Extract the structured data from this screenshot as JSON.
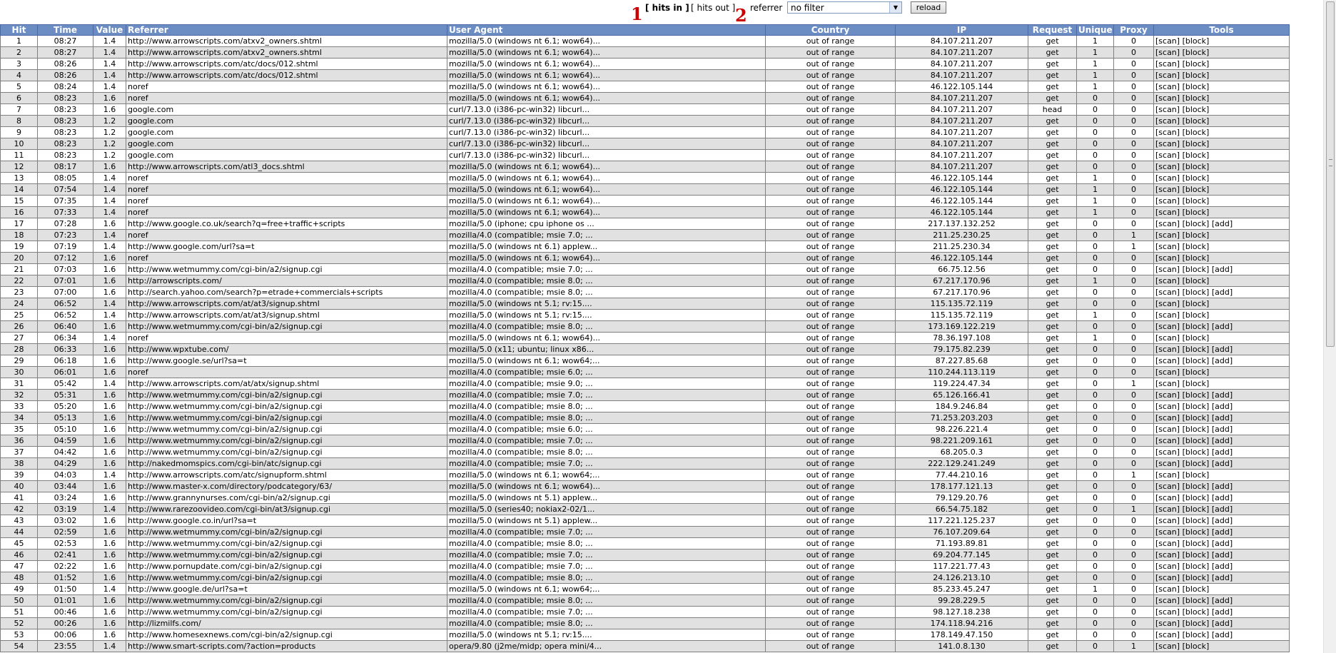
{
  "toolbar": {
    "hits_in": "[ hits in ]",
    "hits_out": "[ hits out ]",
    "filter_label": "referrer",
    "filter_value": "no filter",
    "reload": "reload"
  },
  "annotations": [
    "1",
    "2"
  ],
  "columns": [
    "Hit",
    "Time",
    "Value",
    "Referrer",
    "User Agent",
    "Country",
    "IP",
    "Request",
    "Unique",
    "Proxy",
    "Tools"
  ],
  "rows": [
    [
      "1",
      "08:27",
      "1.4",
      "http://www.arrowscripts.com/atxv2_owners.shtml",
      "mozilla/5.0 (windows nt 6.1; wow64)...",
      "out of range",
      "84.107.211.207",
      "get",
      "1",
      "0",
      "[scan] [block]"
    ],
    [
      "2",
      "08:27",
      "1.4",
      "http://www.arrowscripts.com/atxv2_owners.shtml",
      "mozilla/5.0 (windows nt 6.1; wow64)...",
      "out of range",
      "84.107.211.207",
      "get",
      "1",
      "0",
      "[scan] [block]"
    ],
    [
      "3",
      "08:26",
      "1.4",
      "http://www.arrowscripts.com/atc/docs/012.shtml",
      "mozilla/5.0 (windows nt 6.1; wow64)...",
      "out of range",
      "84.107.211.207",
      "get",
      "1",
      "0",
      "[scan] [block]"
    ],
    [
      "4",
      "08:26",
      "1.4",
      "http://www.arrowscripts.com/atc/docs/012.shtml",
      "mozilla/5.0 (windows nt 6.1; wow64)...",
      "out of range",
      "84.107.211.207",
      "get",
      "1",
      "0",
      "[scan] [block]"
    ],
    [
      "5",
      "08:24",
      "1.4",
      "noref",
      "mozilla/5.0 (windows nt 6.1; wow64)...",
      "out of range",
      "46.122.105.144",
      "get",
      "1",
      "0",
      "[scan] [block]"
    ],
    [
      "6",
      "08:23",
      "1.6",
      "noref",
      "mozilla/5.0 (windows nt 6.1; wow64)...",
      "out of range",
      "84.107.211.207",
      "get",
      "0",
      "0",
      "[scan] [block]"
    ],
    [
      "7",
      "08:23",
      "1.6",
      "google.com",
      "curl/7.13.0 (i386-pc-win32) libcurl...",
      "out of range",
      "84.107.211.207",
      "head",
      "0",
      "0",
      "[scan] [block]"
    ],
    [
      "8",
      "08:23",
      "1.2",
      "google.com",
      "curl/7.13.0 (i386-pc-win32) libcurl...",
      "out of range",
      "84.107.211.207",
      "get",
      "0",
      "0",
      "[scan] [block]"
    ],
    [
      "9",
      "08:23",
      "1.2",
      "google.com",
      "curl/7.13.0 (i386-pc-win32) libcurl...",
      "out of range",
      "84.107.211.207",
      "get",
      "0",
      "0",
      "[scan] [block]"
    ],
    [
      "10",
      "08:23",
      "1.2",
      "google.com",
      "curl/7.13.0 (i386-pc-win32) libcurl...",
      "out of range",
      "84.107.211.207",
      "get",
      "0",
      "0",
      "[scan] [block]"
    ],
    [
      "11",
      "08:23",
      "1.2",
      "google.com",
      "curl/7.13.0 (i386-pc-win32) libcurl...",
      "out of range",
      "84.107.211.207",
      "get",
      "0",
      "0",
      "[scan] [block]"
    ],
    [
      "12",
      "08:17",
      "1.6",
      "http://www.arrowscripts.com/atl3_docs.shtml",
      "mozilla/5.0 (windows nt 6.1; wow64)...",
      "out of range",
      "84.107.211.207",
      "get",
      "0",
      "0",
      "[scan] [block]"
    ],
    [
      "13",
      "08:05",
      "1.4",
      "noref",
      "mozilla/5.0 (windows nt 6.1; wow64)...",
      "out of range",
      "46.122.105.144",
      "get",
      "1",
      "0",
      "[scan] [block]"
    ],
    [
      "14",
      "07:54",
      "1.4",
      "noref",
      "mozilla/5.0 (windows nt 6.1; wow64)...",
      "out of range",
      "46.122.105.144",
      "get",
      "1",
      "0",
      "[scan] [block]"
    ],
    [
      "15",
      "07:35",
      "1.4",
      "noref",
      "mozilla/5.0 (windows nt 6.1; wow64)...",
      "out of range",
      "46.122.105.144",
      "get",
      "1",
      "0",
      "[scan] [block]"
    ],
    [
      "16",
      "07:33",
      "1.4",
      "noref",
      "mozilla/5.0 (windows nt 6.1; wow64)...",
      "out of range",
      "46.122.105.144",
      "get",
      "1",
      "0",
      "[scan] [block]"
    ],
    [
      "17",
      "07:28",
      "1.6",
      "http://www.google.co.uk/search?q=free+traffic+scripts",
      "mozilla/5.0 (iphone; cpu iphone os ...",
      "out of range",
      "217.137.132.252",
      "get",
      "0",
      "0",
      "[scan] [block] [add]"
    ],
    [
      "18",
      "07:23",
      "1.4",
      "noref",
      "mozilla/4.0 (compatible; msie 7.0; ...",
      "out of range",
      "211.25.230.25",
      "get",
      "0",
      "1",
      "[scan] [block]"
    ],
    [
      "19",
      "07:19",
      "1.4",
      "http://www.google.com/url?sa=t",
      "mozilla/5.0 (windows nt 6.1) applew...",
      "out of range",
      "211.25.230.34",
      "get",
      "0",
      "1",
      "[scan] [block]"
    ],
    [
      "20",
      "07:12",
      "1.6",
      "noref",
      "mozilla/5.0 (windows nt 6.1; wow64)...",
      "out of range",
      "46.122.105.144",
      "get",
      "0",
      "0",
      "[scan] [block]"
    ],
    [
      "21",
      "07:03",
      "1.6",
      "http://www.wetmummy.com/cgi-bin/a2/signup.cgi",
      "mozilla/4.0 (compatible; msie 7.0; ...",
      "out of range",
      "66.75.12.56",
      "get",
      "0",
      "0",
      "[scan] [block] [add]"
    ],
    [
      "22",
      "07:01",
      "1.6",
      "http://arrowscripts.com/",
      "mozilla/4.0 (compatible; msie 8.0; ...",
      "out of range",
      "67.217.170.96",
      "get",
      "1",
      "0",
      "[scan] [block]"
    ],
    [
      "23",
      "07:00",
      "1.6",
      "http://search.yahoo.com/search?p=etrade+commercials+scripts",
      "mozilla/4.0 (compatible; msie 8.0; ...",
      "out of range",
      "67.217.170.96",
      "get",
      "0",
      "0",
      "[scan] [block] [add]"
    ],
    [
      "24",
      "06:52",
      "1.4",
      "http://www.arrowscripts.com/at/at3/signup.shtml",
      "mozilla/5.0 (windows nt 5.1; rv:15....",
      "out of range",
      "115.135.72.119",
      "get",
      "0",
      "0",
      "[scan] [block]"
    ],
    [
      "25",
      "06:52",
      "1.4",
      "http://www.arrowscripts.com/at/at3/signup.shtml",
      "mozilla/5.0 (windows nt 5.1; rv:15....",
      "out of range",
      "115.135.72.119",
      "get",
      "1",
      "0",
      "[scan] [block]"
    ],
    [
      "26",
      "06:40",
      "1.6",
      "http://www.wetmummy.com/cgi-bin/a2/signup.cgi",
      "mozilla/4.0 (compatible; msie 8.0; ...",
      "out of range",
      "173.169.122.219",
      "get",
      "0",
      "0",
      "[scan] [block] [add]"
    ],
    [
      "27",
      "06:34",
      "1.4",
      "noref",
      "mozilla/5.0 (windows nt 6.1; wow64)...",
      "out of range",
      "78.36.197.108",
      "get",
      "1",
      "0",
      "[scan] [block]"
    ],
    [
      "28",
      "06:33",
      "1.6",
      "http://www.wpxtube.com/",
      "mozilla/5.0 (x11; ubuntu; linux x86...",
      "out of range",
      "79.175.82.239",
      "get",
      "0",
      "0",
      "[scan] [block] [add]"
    ],
    [
      "29",
      "06:18",
      "1.6",
      "http://www.google.se/url?sa=t",
      "mozilla/5.0 (windows nt 6.1; wow64;...",
      "out of range",
      "87.227.85.68",
      "get",
      "0",
      "0",
      "[scan] [block] [add]"
    ],
    [
      "30",
      "06:01",
      "1.6",
      "noref",
      "mozilla/4.0 (compatible; msie 6.0; ...",
      "out of range",
      "110.244.113.119",
      "get",
      "0",
      "0",
      "[scan] [block]"
    ],
    [
      "31",
      "05:42",
      "1.4",
      "http://www.arrowscripts.com/at/atx/signup.shtml",
      "mozilla/4.0 (compatible; msie 9.0; ...",
      "out of range",
      "119.224.47.34",
      "get",
      "0",
      "1",
      "[scan] [block]"
    ],
    [
      "32",
      "05:31",
      "1.6",
      "http://www.wetmummy.com/cgi-bin/a2/signup.cgi",
      "mozilla/4.0 (compatible; msie 7.0; ...",
      "out of range",
      "65.126.166.41",
      "get",
      "0",
      "0",
      "[scan] [block] [add]"
    ],
    [
      "33",
      "05:20",
      "1.6",
      "http://www.wetmummy.com/cgi-bin/a2/signup.cgi",
      "mozilla/4.0 (compatible; msie 8.0; ...",
      "out of range",
      "184.9.246.84",
      "get",
      "0",
      "0",
      "[scan] [block] [add]"
    ],
    [
      "34",
      "05:13",
      "1.6",
      "http://www.wetmummy.com/cgi-bin/a2/signup.cgi",
      "mozilla/4.0 (compatible; msie 8.0; ...",
      "out of range",
      "71.253.203.203",
      "get",
      "0",
      "0",
      "[scan] [block] [add]"
    ],
    [
      "35",
      "05:10",
      "1.6",
      "http://www.wetmummy.com/cgi-bin/a2/signup.cgi",
      "mozilla/4.0 (compatible; msie 6.0; ...",
      "out of range",
      "98.226.221.4",
      "get",
      "0",
      "0",
      "[scan] [block] [add]"
    ],
    [
      "36",
      "04:59",
      "1.6",
      "http://www.wetmummy.com/cgi-bin/a2/signup.cgi",
      "mozilla/4.0 (compatible; msie 7.0; ...",
      "out of range",
      "98.221.209.161",
      "get",
      "0",
      "0",
      "[scan] [block] [add]"
    ],
    [
      "37",
      "04:42",
      "1.6",
      "http://www.wetmummy.com/cgi-bin/a2/signup.cgi",
      "mozilla/4.0 (compatible; msie 8.0; ...",
      "out of range",
      "68.205.0.3",
      "get",
      "0",
      "0",
      "[scan] [block] [add]"
    ],
    [
      "38",
      "04:29",
      "1.6",
      "http://nakedmomspics.com/cgi-bin/atc/signup.cgi",
      "mozilla/4.0 (compatible; msie 7.0; ...",
      "out of range",
      "222.129.241.249",
      "get",
      "0",
      "0",
      "[scan] [block] [add]"
    ],
    [
      "39",
      "04:03",
      "1.4",
      "http://www.arrowscripts.com/atc/signupform.shtml",
      "mozilla/5.0 (windows nt 6.1; wow64;...",
      "out of range",
      "77.44.210.16",
      "get",
      "0",
      "1",
      "[scan] [block]"
    ],
    [
      "40",
      "03:44",
      "1.6",
      "http://www.master-x.com/directory/podcategory/63/",
      "mozilla/5.0 (windows nt 6.1; wow64)...",
      "out of range",
      "178.177.121.13",
      "get",
      "0",
      "0",
      "[scan] [block] [add]"
    ],
    [
      "41",
      "03:24",
      "1.6",
      "http://www.grannynurses.com/cgi-bin/a2/signup.cgi",
      "mozilla/5.0 (windows nt 5.1) applew...",
      "out of range",
      "79.129.20.76",
      "get",
      "0",
      "0",
      "[scan] [block] [add]"
    ],
    [
      "42",
      "03:19",
      "1.4",
      "http://www.rarezoovideo.com/cgi-bin/at3/signup.cgi",
      "mozilla/5.0 (series40; nokiax2-02/1...",
      "out of range",
      "66.54.75.182",
      "get",
      "0",
      "1",
      "[scan] [block] [add]"
    ],
    [
      "43",
      "03:02",
      "1.6",
      "http://www.google.co.in/url?sa=t",
      "mozilla/5.0 (windows nt 5.1) applew...",
      "out of range",
      "117.221.125.237",
      "get",
      "0",
      "0",
      "[scan] [block] [add]"
    ],
    [
      "44",
      "02:59",
      "1.6",
      "http://www.wetmummy.com/cgi-bin/a2/signup.cgi",
      "mozilla/4.0 (compatible; msie 7.0; ...",
      "out of range",
      "76.107.209.64",
      "get",
      "0",
      "0",
      "[scan] [block] [add]"
    ],
    [
      "45",
      "02:53",
      "1.6",
      "http://www.wetmummy.com/cgi-bin/a2/signup.cgi",
      "mozilla/4.0 (compatible; msie 8.0; ...",
      "out of range",
      "71.193.89.81",
      "get",
      "0",
      "0",
      "[scan] [block] [add]"
    ],
    [
      "46",
      "02:41",
      "1.6",
      "http://www.wetmummy.com/cgi-bin/a2/signup.cgi",
      "mozilla/4.0 (compatible; msie 7.0; ...",
      "out of range",
      "69.204.77.145",
      "get",
      "0",
      "0",
      "[scan] [block] [add]"
    ],
    [
      "47",
      "02:22",
      "1.6",
      "http://www.pornupdate.com/cgi-bin/a2/signup.cgi",
      "mozilla/4.0 (compatible; msie 7.0; ...",
      "out of range",
      "117.221.77.43",
      "get",
      "0",
      "0",
      "[scan] [block] [add]"
    ],
    [
      "48",
      "01:52",
      "1.6",
      "http://www.wetmummy.com/cgi-bin/a2/signup.cgi",
      "mozilla/4.0 (compatible; msie 8.0; ...",
      "out of range",
      "24.126.213.10",
      "get",
      "0",
      "0",
      "[scan] [block] [add]"
    ],
    [
      "49",
      "01:50",
      "1.4",
      "http://www.google.de/url?sa=t",
      "mozilla/5.0 (windows nt 6.1; wow64;...",
      "out of range",
      "85.233.45.247",
      "get",
      "1",
      "0",
      "[scan] [block]"
    ],
    [
      "50",
      "01:01",
      "1.6",
      "http://www.wetmummy.com/cgi-bin/a2/signup.cgi",
      "mozilla/4.0 (compatible; msie 8.0; ...",
      "out of range",
      "99.28.229.5",
      "get",
      "0",
      "0",
      "[scan] [block] [add]"
    ],
    [
      "51",
      "00:46",
      "1.6",
      "http://www.wetmummy.com/cgi-bin/a2/signup.cgi",
      "mozilla/4.0 (compatible; msie 7.0; ...",
      "out of range",
      "98.127.18.238",
      "get",
      "0",
      "0",
      "[scan] [block] [add]"
    ],
    [
      "52",
      "00:26",
      "1.6",
      "http://lizmilfs.com/",
      "mozilla/4.0 (compatible; msie 8.0; ...",
      "out of range",
      "174.118.94.216",
      "get",
      "0",
      "0",
      "[scan] [block] [add]"
    ],
    [
      "53",
      "00:06",
      "1.6",
      "http://www.homesexnews.com/cgi-bin/a2/signup.cgi",
      "mozilla/5.0 (windows nt 5.1; rv:15....",
      "out of range",
      "178.149.47.150",
      "get",
      "0",
      "0",
      "[scan] [block] [add]"
    ],
    [
      "54",
      "23:55",
      "1.4",
      "http://www.smart-scripts.com/?action=products",
      "opera/9.80 (j2me/midp; opera mini/4...",
      "out of range",
      "141.0.8.130",
      "get",
      "0",
      "1",
      "[scan] [block]"
    ]
  ]
}
